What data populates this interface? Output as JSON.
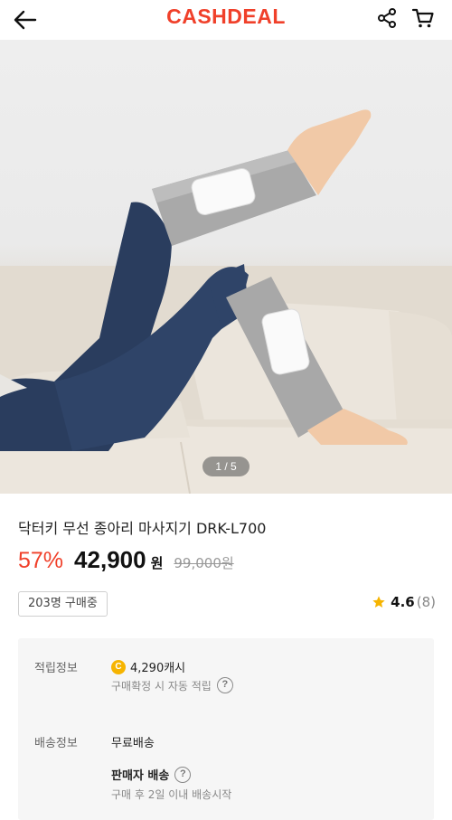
{
  "header": {
    "logo": "CASHDEAL",
    "back_icon": "arrow-left-icon",
    "share_icon": "share-icon",
    "cart_icon": "cart-icon"
  },
  "gallery": {
    "counter": "1 / 5"
  },
  "product": {
    "title": "닥터키 무선 종아리 마사지기 DRK-L700",
    "discount": "57%",
    "price": "42,900",
    "currency": "원",
    "original_price": "99,000원",
    "buyers_badge": "203명 구매중",
    "rating": "4.6",
    "review_count": "(8)"
  },
  "info": {
    "reward_label": "적립정보",
    "reward_coin": "C",
    "reward_value": "4,290캐시",
    "reward_note": "구매확정 시 자동 적립",
    "shipping_label": "배송정보",
    "shipping_value": "무료배송",
    "seller_shipping": "판매자 배송",
    "shipping_note": "구매 후 2일 이내 배송시작"
  },
  "colors": {
    "brand": "#f0402a",
    "star": "#f6b400"
  }
}
